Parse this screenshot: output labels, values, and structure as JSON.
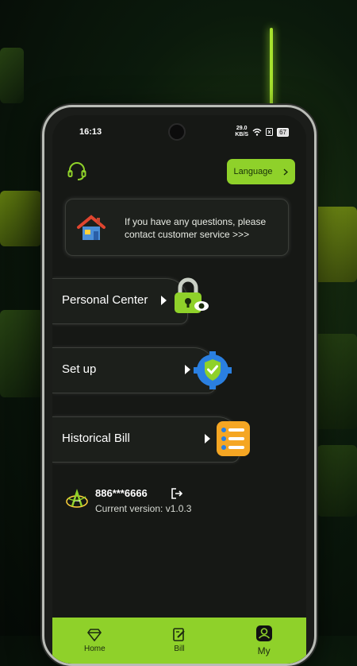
{
  "status": {
    "time": "16:13",
    "net_speed_top": "29.0",
    "net_speed_bottom": "KB/S",
    "battery": "67"
  },
  "header": {
    "support_icon": "headset-icon",
    "language_label": "Language"
  },
  "notice": {
    "text": "If you have any questions, please contact customer service >>>",
    "icon": "house-icon"
  },
  "menu": [
    {
      "label": "Personal Center",
      "icon": "padlock-eye-icon"
    },
    {
      "label": "Set up",
      "icon": "shield-gear-icon"
    },
    {
      "label": "Historical Bill",
      "icon": "checklist-icon"
    }
  ],
  "user": {
    "phone": "886***6666",
    "version": "Current version: v1.0.3"
  },
  "tabs": [
    {
      "label": "Home",
      "icon": "diamond-icon"
    },
    {
      "label": "Bill",
      "icon": "edit-note-icon"
    },
    {
      "label": "My",
      "icon": "profile-icon"
    }
  ],
  "colors": {
    "accent": "#8fd12a",
    "background": "#161815"
  }
}
